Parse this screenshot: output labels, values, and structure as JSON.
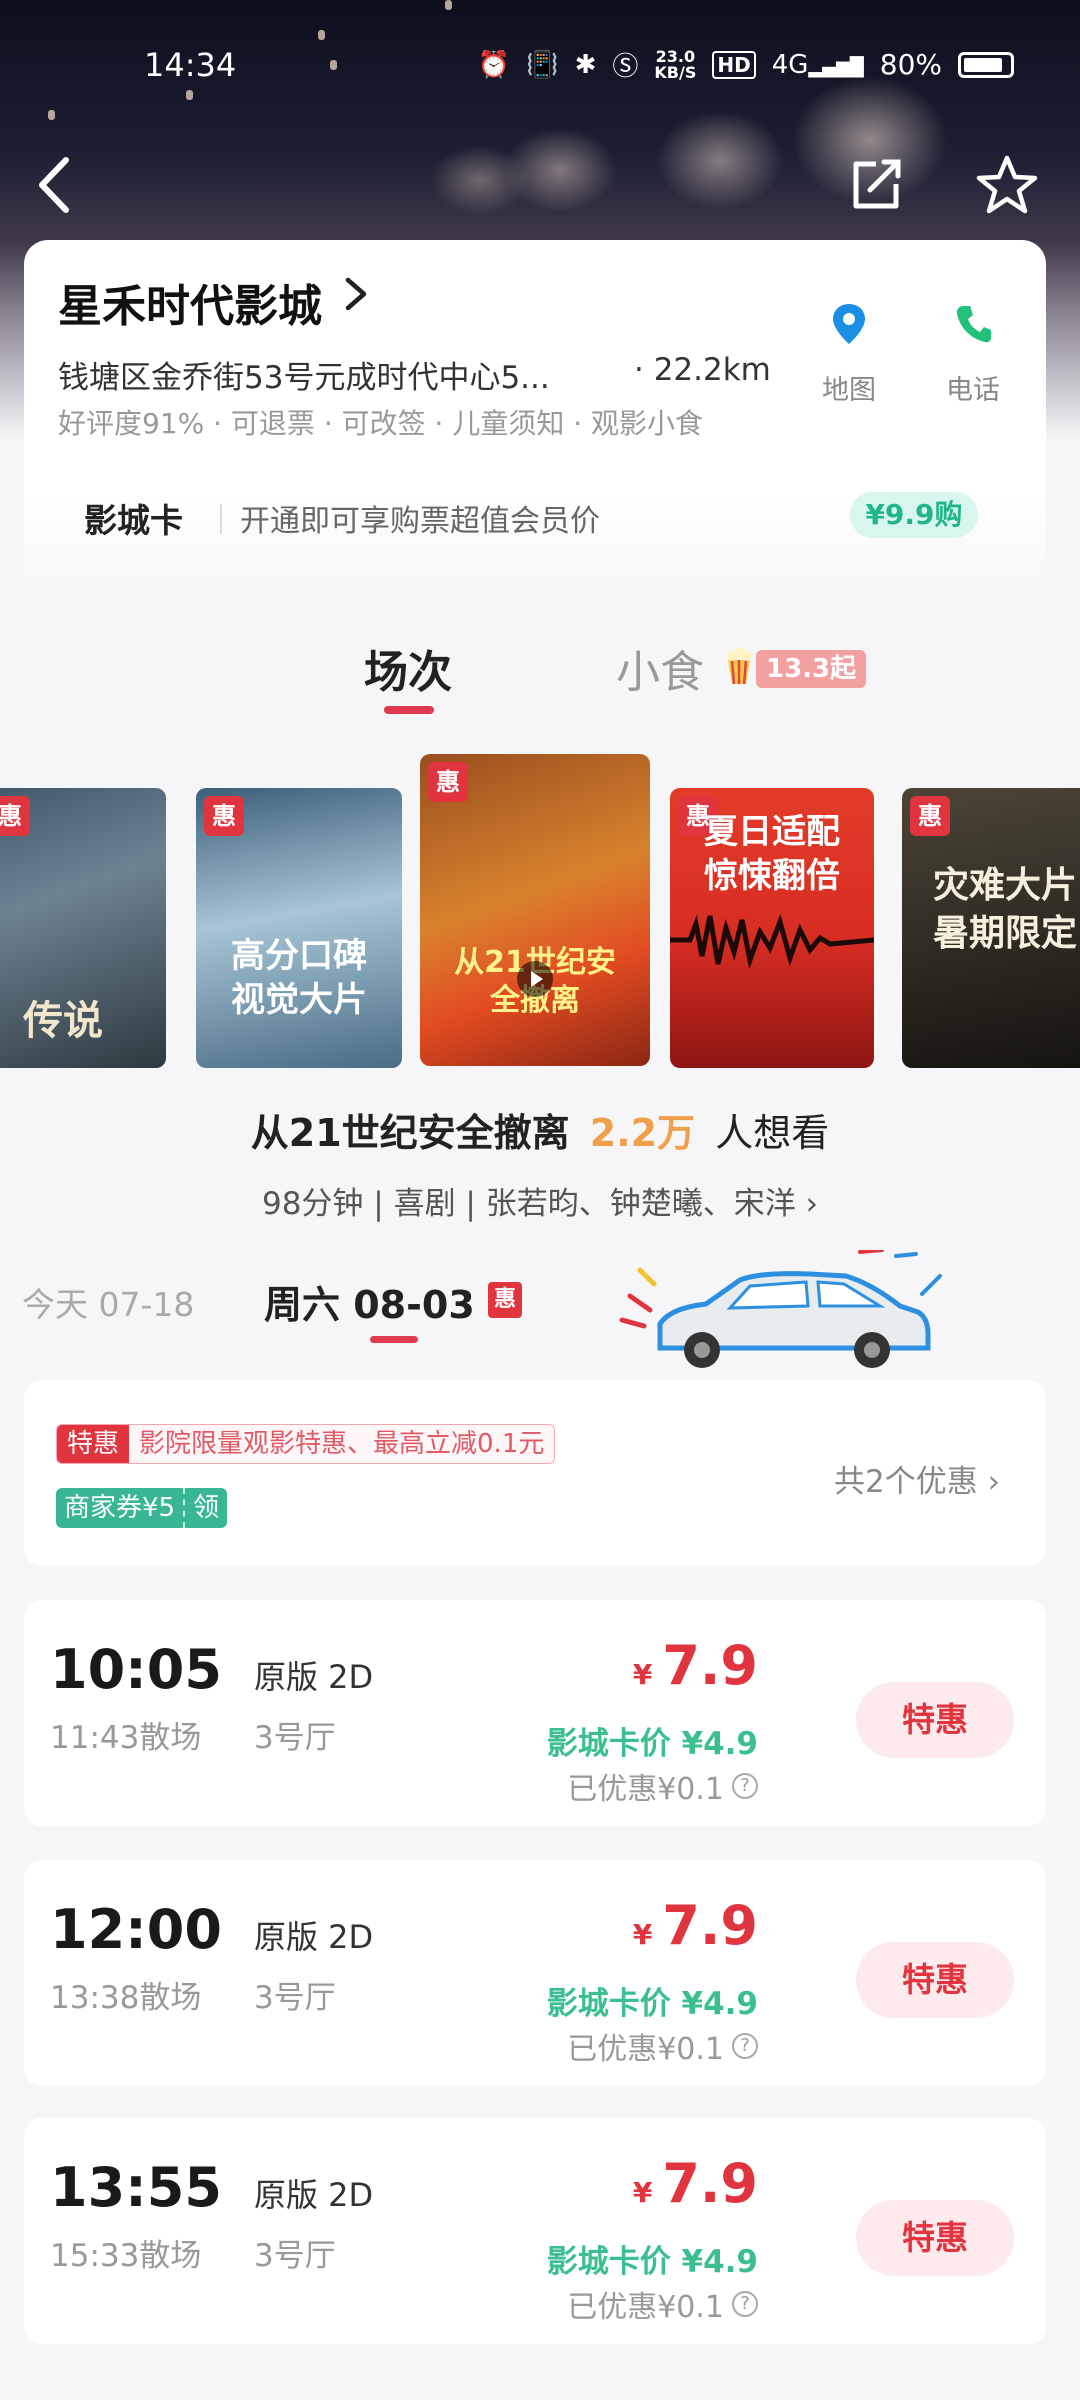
{
  "status_bar": {
    "time": "14:34",
    "net_speed_value": "23.0",
    "net_speed_unit": "KB/S",
    "hd": "HD",
    "signal": "4G",
    "battery": "80%"
  },
  "cinema": {
    "name": "星禾时代影城",
    "address": "钱塘区金乔街53号元成时代中心5...",
    "distance": "· 22.2km",
    "tags": "好评度91% · 可退票 · 可改签 · 儿童须知 · 观影小食",
    "actions": {
      "map": "地图",
      "phone": "电话"
    }
  },
  "member_card": {
    "title": "影城卡",
    "description": "开通即可享购票超值会员价",
    "button": "¥9.9购"
  },
  "tabs": {
    "sessions": "场次",
    "snacks": "小食",
    "snacks_price": "13.3起"
  },
  "posters": [
    {
      "badge": "惠",
      "text": "传说"
    },
    {
      "badge": "惠",
      "text": "高分口碑 视觉大片"
    },
    {
      "badge": "惠",
      "text": "从21世纪安全撤离"
    },
    {
      "badge": "惠",
      "text": "夏日适配 惊悚翻倍"
    },
    {
      "badge": "惠",
      "text": "灾难大片 暑期限定"
    }
  ],
  "movie": {
    "title": "从21世纪安全撤离",
    "want_count": "2.2万",
    "want_suffix": "人想看",
    "meta": "98分钟 | 喜剧 | 张若昀、钟楚曦、宋洋 ›"
  },
  "dates": {
    "today": "今天 07-18",
    "selected_day": "周六 08-03",
    "selected_badge": "惠"
  },
  "promotions": {
    "special_label": "特惠",
    "special_text": "影院限量观影特惠、最高立减0.1元",
    "coupon_label": "商家券¥5",
    "coupon_action": "领",
    "count_text": "共2个优惠 ›"
  },
  "sessions": [
    {
      "start": "10:05",
      "end": "11:43散场",
      "version": "原版 2D",
      "hall": "3号厅",
      "currency": "¥",
      "price": "7.9",
      "card_price": "影城卡价 ¥4.9",
      "discount": "已优惠¥0.1",
      "button": "特惠"
    },
    {
      "start": "12:00",
      "end": "13:38散场",
      "version": "原版 2D",
      "hall": "3号厅",
      "currency": "¥",
      "price": "7.9",
      "card_price": "影城卡价 ¥4.9",
      "discount": "已优惠¥0.1",
      "button": "特惠"
    },
    {
      "start": "13:55",
      "end": "15:33散场",
      "version": "原版 2D",
      "hall": "3号厅",
      "currency": "¥",
      "price": "7.9",
      "card_price": "影城卡价 ¥4.9",
      "discount": "已优惠¥0.1",
      "button": "特惠"
    }
  ],
  "colors": {
    "accent_red": "#e0353f",
    "green": "#3cbf8e",
    "orange": "#f0a04b"
  }
}
